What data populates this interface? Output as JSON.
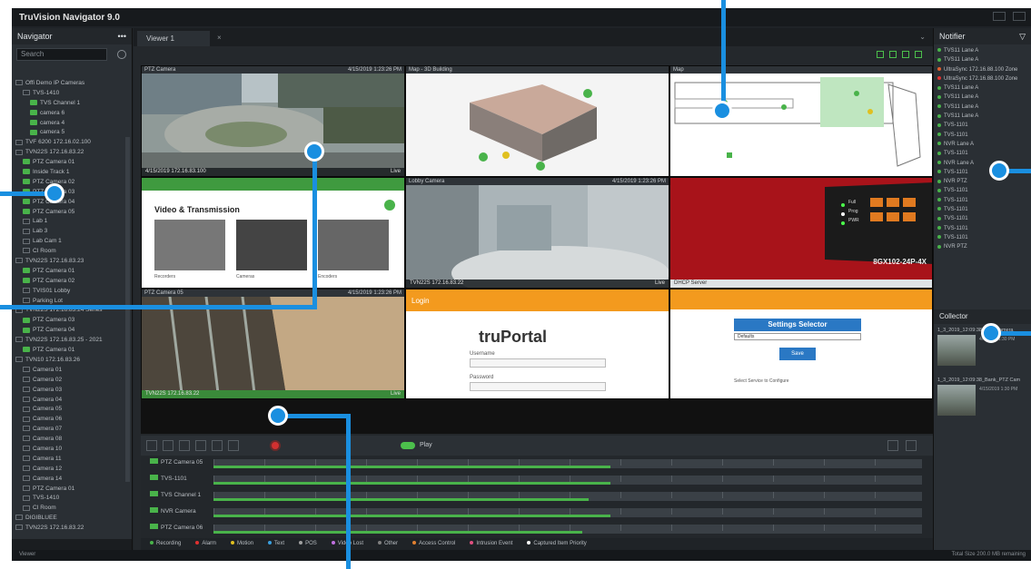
{
  "app": {
    "title": "TruVision Navigator 9.0"
  },
  "navigator": {
    "title": "Navigator",
    "menu": "•••",
    "search_placeholder": "Search",
    "tree": [
      {
        "label": "Offi Demo IP Cameras",
        "kind": "dev",
        "indent": 0
      },
      {
        "label": "TVS-1410",
        "kind": "dev",
        "indent": 1
      },
      {
        "label": "TVS Channel 1",
        "kind": "cam",
        "indent": 2
      },
      {
        "label": "camera 6",
        "kind": "cam",
        "indent": 2
      },
      {
        "label": "camera 4",
        "kind": "cam",
        "indent": 2
      },
      {
        "label": "camera 5",
        "kind": "cam",
        "indent": 2
      },
      {
        "label": "TVF 6200 172.16.02.100",
        "kind": "dev",
        "indent": 0
      },
      {
        "label": "TVN22S 172.16.83.22",
        "kind": "dev",
        "indent": 0
      },
      {
        "label": "PTZ Camera 01",
        "kind": "cam",
        "indent": 1
      },
      {
        "label": "Inside Track 1",
        "kind": "cam",
        "indent": 1
      },
      {
        "label": "PTZ Camera 02",
        "kind": "cam",
        "indent": 1
      },
      {
        "label": "PTZ Camera 03",
        "kind": "cam",
        "indent": 1
      },
      {
        "label": "PTZ Camera 04",
        "kind": "cam",
        "indent": 1
      },
      {
        "label": "PTZ Camera 05",
        "kind": "cam",
        "indent": 1
      },
      {
        "label": "Lab 1",
        "kind": "dev",
        "indent": 1
      },
      {
        "label": "Lab 3",
        "kind": "dev",
        "indent": 1
      },
      {
        "label": "Lab Cam 1",
        "kind": "dev",
        "indent": 1
      },
      {
        "label": "CI Room",
        "kind": "dev",
        "indent": 1
      },
      {
        "label": "TVN22S 172.16.83.23",
        "kind": "dev",
        "indent": 0
      },
      {
        "label": "PTZ Camera 01",
        "kind": "cam",
        "indent": 1
      },
      {
        "label": "PTZ Camera 02",
        "kind": "cam",
        "indent": 1
      },
      {
        "label": "TVIS01 Lobby",
        "kind": "dev",
        "indent": 1
      },
      {
        "label": "Parking Lot",
        "kind": "dev",
        "indent": 1
      },
      {
        "label": "TVN22S 172.16.83.24 Series",
        "kind": "dev",
        "indent": 0
      },
      {
        "label": "PTZ Camera 03",
        "kind": "cam",
        "indent": 1
      },
      {
        "label": "PTZ Camera 04",
        "kind": "cam",
        "indent": 1
      },
      {
        "label": "TVN22S 172.16.83.25 - 2021",
        "kind": "dev",
        "indent": 0
      },
      {
        "label": "PTZ Camera 01",
        "kind": "cam",
        "indent": 1
      },
      {
        "label": "TVN10 172.16.83.26",
        "kind": "dev",
        "indent": 0
      },
      {
        "label": "Camera 01",
        "kind": "dev",
        "indent": 1
      },
      {
        "label": "Camera 02",
        "kind": "dev",
        "indent": 1
      },
      {
        "label": "Camera 03",
        "kind": "dev",
        "indent": 1
      },
      {
        "label": "Camera 04",
        "kind": "dev",
        "indent": 1
      },
      {
        "label": "Camera 05",
        "kind": "dev",
        "indent": 1
      },
      {
        "label": "Camera 06",
        "kind": "dev",
        "indent": 1
      },
      {
        "label": "Camera 07",
        "kind": "dev",
        "indent": 1
      },
      {
        "label": "Camera 08",
        "kind": "dev",
        "indent": 1
      },
      {
        "label": "Camera 10",
        "kind": "dev",
        "indent": 1
      },
      {
        "label": "Camera 11",
        "kind": "dev",
        "indent": 1
      },
      {
        "label": "Camera 12",
        "kind": "dev",
        "indent": 1
      },
      {
        "label": "Camera 14",
        "kind": "dev",
        "indent": 1
      },
      {
        "label": "PTZ Camera 01",
        "kind": "dev",
        "indent": 1
      },
      {
        "label": "TVS-1410",
        "kind": "dev",
        "indent": 1
      },
      {
        "label": "CI Room",
        "kind": "dev",
        "indent": 1
      },
      {
        "label": "DIGIBLUEE",
        "kind": "dev",
        "indent": 0
      },
      {
        "label": "TVN22S 172.16.83.22",
        "kind": "dev",
        "indent": 0
      }
    ]
  },
  "center": {
    "tab_label": "Viewer 1",
    "tab_close": "×",
    "tiles": [
      {
        "title": "PTZ Camera",
        "timestamp": "4/15/2019 1:23:26 PM",
        "footer": "4/15/2019 172.16.83.100",
        "footer_right": "Live"
      },
      {
        "title": "Map - 3D Building",
        "timestamp": "",
        "footer": "",
        "footer_right": ""
      },
      {
        "title": "Map",
        "timestamp": "",
        "footer": "",
        "footer_right": ""
      },
      {
        "title": "Video & Transmission",
        "timestamp": "",
        "footer": "",
        "footer_right": ""
      },
      {
        "title": "Lobby Camera",
        "timestamp": "4/15/2019 1:23:26 PM",
        "footer": "TVN22S 172.16.83.22",
        "footer_right": "Live"
      },
      {
        "title": "",
        "timestamp": "",
        "footer": "DHCP Server",
        "footer_right": ""
      },
      {
        "title": "PTZ Camera 05",
        "timestamp": "4/15/2019 1:23:26 PM",
        "footer": "TVN22S 172.16.83.22",
        "footer_right": "Live"
      },
      {
        "title": "Login",
        "timestamp": "",
        "footer": "",
        "footer_right": ""
      },
      {
        "title": "Settings Selector",
        "timestamp": "",
        "footer": "",
        "footer_right": ""
      }
    ],
    "web_tile": {
      "heading": "Video & Transmission",
      "captions": [
        "Recorders",
        "Cameras",
        "Encoders"
      ]
    },
    "truportal": {
      "header": "Login",
      "logo": "truPortal",
      "username_label": "Username",
      "password_label": "Password"
    },
    "settings": {
      "header": "Settings Selector",
      "option": "Defaults",
      "save": "Save",
      "footer": "Select Service to Configure"
    },
    "switch_label": "8GX102-24P-4X",
    "switch_legend": [
      "Full",
      "Prog",
      "PWR"
    ]
  },
  "timeline": {
    "toggle_label": "Play",
    "rows": [
      {
        "label": "PTZ Camera 05",
        "bar": 0.56
      },
      {
        "label": "TVS-1101",
        "bar": 0.56
      },
      {
        "label": "TVS Channel 1",
        "bar": 0.53
      },
      {
        "label": "NVR Camera",
        "bar": 0.56
      },
      {
        "label": "PTZ Camera 06",
        "bar": 0.52
      }
    ],
    "legend": [
      {
        "label": "Recording",
        "color": "#49b34a"
      },
      {
        "label": "Alarm",
        "color": "#e03030"
      },
      {
        "label": "Motion",
        "color": "#e0c020"
      },
      {
        "label": "Text",
        "color": "#3aa0e0"
      },
      {
        "label": "POS",
        "color": "#a0a0a0"
      },
      {
        "label": "Video Lost",
        "color": "#c070e0"
      },
      {
        "label": "Other",
        "color": "#808080"
      },
      {
        "label": "Access Control",
        "color": "#e08030"
      },
      {
        "label": "Intrusion Event",
        "color": "#e05080"
      },
      {
        "label": "Captured Item Priority",
        "color": "#ffffff"
      }
    ]
  },
  "right": {
    "title": "Notifier",
    "alarms": [
      {
        "label": "TVS11 Lane A",
        "color": "#49b34a"
      },
      {
        "label": "TVS11 Lane A",
        "color": "#49b34a"
      },
      {
        "label": "UltraSync 172.16.88.100 Zone",
        "color": "#e06030"
      },
      {
        "label": "UltraSync 172.16.88.100 Zone",
        "color": "#e03030"
      },
      {
        "label": "TVS11 Lane A",
        "color": "#49b34a"
      },
      {
        "label": "TVS11 Lane A",
        "color": "#49b34a"
      },
      {
        "label": "TVS11 Lane A",
        "color": "#49b34a"
      },
      {
        "label": "TVS11 Lane A",
        "color": "#49b34a"
      },
      {
        "label": "TVS-1101",
        "color": "#49b34a"
      },
      {
        "label": "TVS-1101",
        "color": "#49b34a"
      },
      {
        "label": "NVR Lane A",
        "color": "#49b34a"
      },
      {
        "label": "TVS-1101",
        "color": "#49b34a"
      },
      {
        "label": "NVR Lane A",
        "color": "#49b34a"
      },
      {
        "label": "TVS-1101",
        "color": "#49b34a"
      },
      {
        "label": "NVR PTZ",
        "color": "#49b34a"
      },
      {
        "label": "TVS-1101",
        "color": "#49b34a"
      },
      {
        "label": "TVS-1101",
        "color": "#49b34a"
      },
      {
        "label": "TVS-1101",
        "color": "#49b34a"
      },
      {
        "label": "TVS-1101",
        "color": "#49b34a"
      },
      {
        "label": "TVS-1101",
        "color": "#49b34a"
      },
      {
        "label": "TVS-1101",
        "color": "#49b34a"
      },
      {
        "label": "NVR PTZ",
        "color": "#49b34a"
      }
    ],
    "collector_title": "Collector",
    "collection": [
      {
        "name": "1_3_2019_12:09:38_PTZ Camera",
        "meta": "4/1/2019 1:30 PM"
      },
      {
        "name": "1_3_2019_12:09:38_Bank_PTZ Cam",
        "meta": "4/15/2019 1:30 PM"
      }
    ]
  },
  "status": {
    "left": "Viewer",
    "right": "Total Size    200.0 MB remaining"
  }
}
